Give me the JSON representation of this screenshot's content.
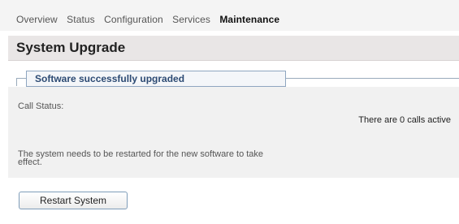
{
  "nav": {
    "items": [
      {
        "label": "Overview"
      },
      {
        "label": "Status"
      },
      {
        "label": "Configuration"
      },
      {
        "label": "Services"
      },
      {
        "label": "Maintenance"
      }
    ]
  },
  "page": {
    "title": "System Upgrade"
  },
  "status": {
    "legend": "Software successfully upgraded",
    "call_status_label": "Call Status:",
    "call_status_value": "There are 0 calls active",
    "restart_note": "The system needs to be restarted for the new software to take effect."
  },
  "actions": {
    "restart_label": "Restart System"
  }
}
